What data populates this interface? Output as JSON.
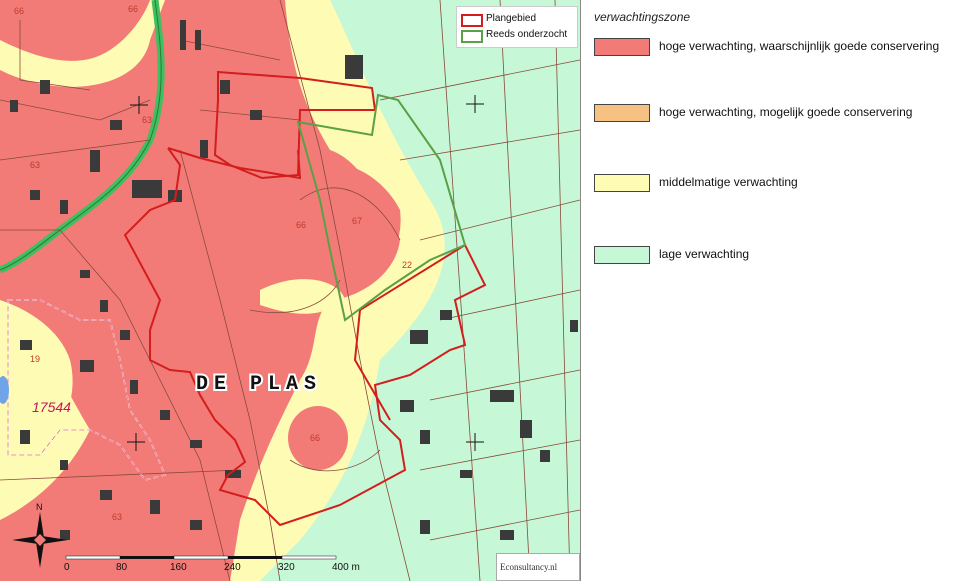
{
  "map": {
    "place_label": "DE PLAS",
    "feature_label": "17544",
    "zone_numbers": [
      "66",
      "63",
      "63",
      "66",
      "67",
      "22",
      "66",
      "63",
      "19"
    ],
    "colors": {
      "high_good": "#f27b78",
      "high_possible": "#f7c184",
      "medium": "#fefbb4",
      "low": "#c6f7d6",
      "plan_outline": "#d41d1d",
      "investigated_outline": "#5aa046",
      "road_green": "#3fbf5f",
      "parcel_line": "#8a4a3a",
      "building": "#3a3a3a"
    }
  },
  "map_legend": {
    "items": [
      {
        "label": "Plangebied",
        "color": "#d41d1d",
        "icon": "red-outline-box"
      },
      {
        "label": "Reeds onderzocht",
        "color": "#5aa046",
        "icon": "green-outline-box"
      }
    ]
  },
  "legend": {
    "title": "verwachtingszone",
    "items": [
      {
        "label": "hoge verwachting, waarschijnlijk goede conservering",
        "color": "#f27b78"
      },
      {
        "label": "hoge verwachting, mogelijk goede conservering",
        "color": "#f7c184"
      },
      {
        "label": "middelmatige verwachting",
        "color": "#fefbb4"
      },
      {
        "label": "lage verwachting",
        "color": "#c6f7d6"
      }
    ]
  },
  "scalebar": {
    "ticks": [
      "0",
      "80",
      "160",
      "240",
      "320",
      "400 m"
    ],
    "north": "N"
  },
  "logo": {
    "text": "Econsultancy.nl"
  }
}
